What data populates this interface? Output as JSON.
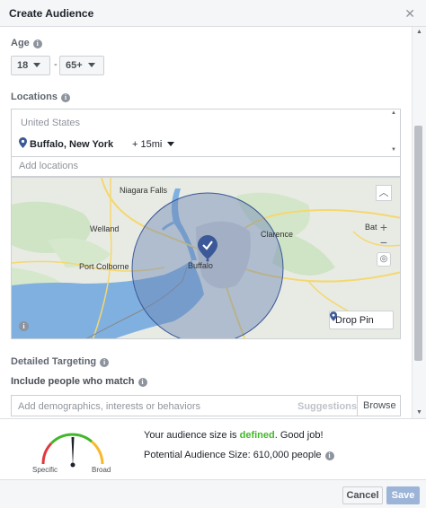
{
  "header": {
    "title": "Create Audience",
    "close_icon": "close-icon"
  },
  "age": {
    "label": "Age",
    "min": "18",
    "separator": "-",
    "max": "65+"
  },
  "locations": {
    "label": "Locations",
    "country": "United States",
    "city": "Buffalo, New York",
    "radius": "+ 15mi",
    "add_placeholder": "Add locations"
  },
  "map": {
    "places": {
      "niagara_falls": "Niagara Falls",
      "welland": "Welland",
      "port_colborne": "Port Colborne",
      "buffalo": "Buffalo",
      "clarence": "Clarence",
      "batavia": "Bat"
    },
    "drop_pin_label": "Drop Pin",
    "zoom_in": "+",
    "zoom_out": "−",
    "info": "i",
    "colors": {
      "water": "#7fb0e0",
      "land": "#e8ebe4",
      "radius_fill": "#6d84b4",
      "pin": "#3b5998"
    }
  },
  "targeting": {
    "section_label": "Detailed Targeting",
    "include_label": "Include people who match",
    "input_placeholder": "Add demographics, interests or behaviors",
    "suggestions_label": "Suggestions",
    "browse_label": "Browse"
  },
  "audience": {
    "status_prefix": "Your audience size is ",
    "status_value": "defined",
    "status_suffix": ". Good job!",
    "potential_size": "Potential Audience Size: 610,000 people",
    "gauge_left": "Specific",
    "gauge_right": "Broad",
    "status_color": "#42b72a"
  },
  "footer": {
    "cancel_label": "Cancel",
    "save_label": "Save"
  }
}
